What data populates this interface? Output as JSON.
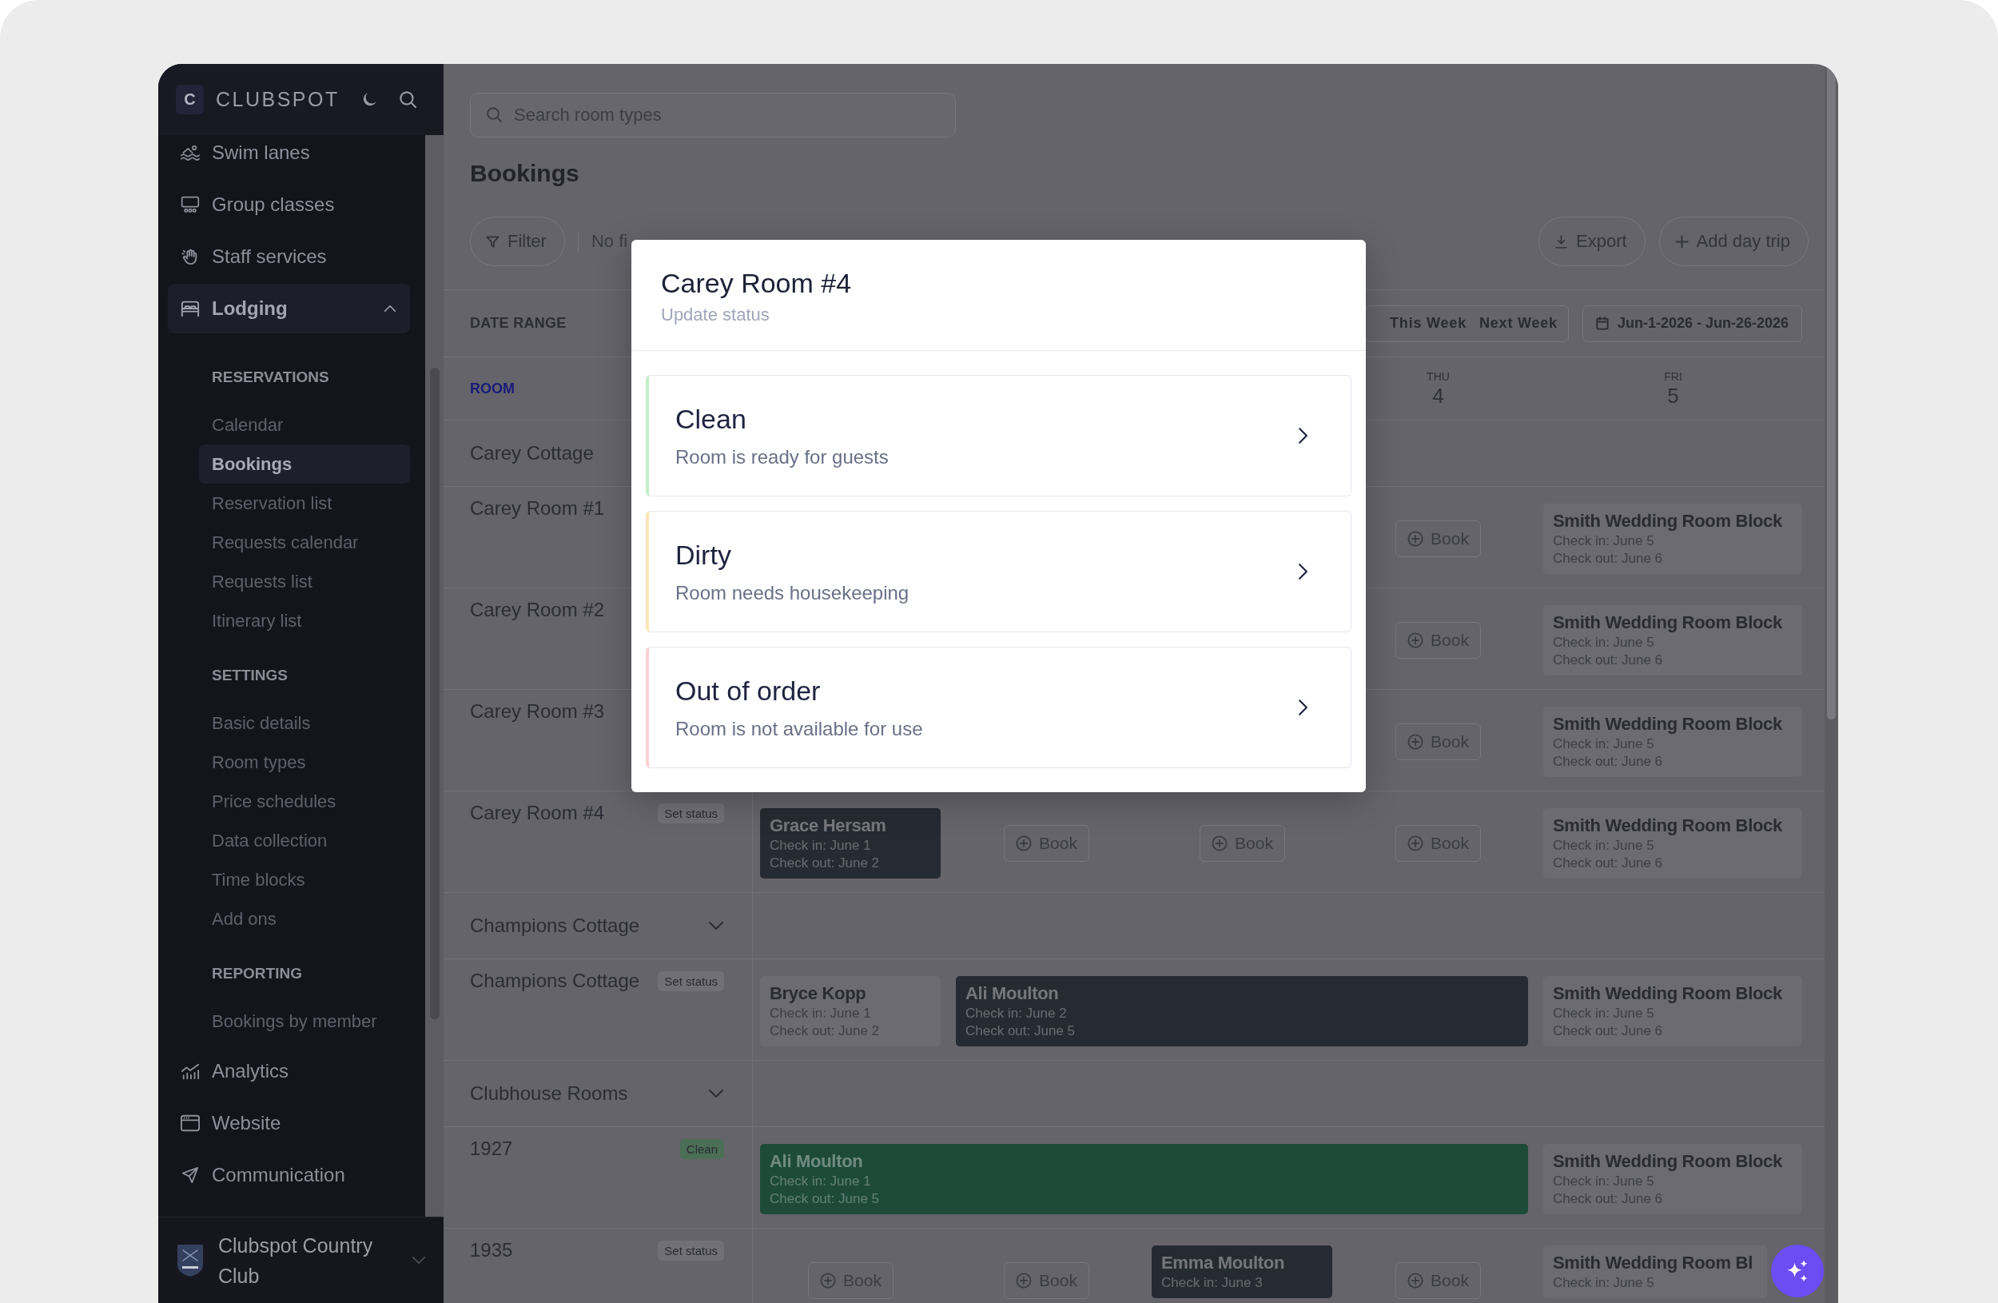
{
  "sidebar": {
    "brand": {
      "logo": "C",
      "name": "CLUBSPOT"
    },
    "nav": [
      {
        "label": "Swim lanes",
        "selected": false
      },
      {
        "label": "Group classes",
        "selected": false
      },
      {
        "label": "Staff services",
        "selected": false
      },
      {
        "label": "Lodging",
        "selected": true,
        "expanded": true,
        "sections": [
          {
            "heading": "RESERVATIONS",
            "items": [
              {
                "label": "Calendar",
                "selected": false
              },
              {
                "label": "Bookings",
                "selected": true
              },
              {
                "label": "Reservation list",
                "selected": false
              },
              {
                "label": "Requests calendar",
                "selected": false
              },
              {
                "label": "Requests list",
                "selected": false
              },
              {
                "label": "Itinerary list",
                "selected": false
              }
            ]
          },
          {
            "heading": "SETTINGS",
            "items": [
              {
                "label": "Basic details",
                "selected": false
              },
              {
                "label": "Room types",
                "selected": false
              },
              {
                "label": "Price schedules",
                "selected": false
              },
              {
                "label": "Data collection",
                "selected": false
              },
              {
                "label": "Time blocks",
                "selected": false
              },
              {
                "label": "Add ons",
                "selected": false
              }
            ]
          },
          {
            "heading": "REPORTING",
            "items": [
              {
                "label": "Bookings by member",
                "selected": false
              }
            ]
          }
        ]
      },
      {
        "label": "Analytics",
        "selected": false
      },
      {
        "label": "Website",
        "selected": false
      },
      {
        "label": "Communication",
        "selected": false
      }
    ],
    "club": {
      "name": "Clubspot Country Club"
    }
  },
  "main": {
    "search": {
      "placeholder": "Search room types"
    },
    "title": "Bookings",
    "toolbar": {
      "filter": "Filter",
      "filter_summary": "No fi",
      "actions": [
        {
          "label": "Export"
        },
        {
          "label": "Add day trip"
        }
      ]
    },
    "date_range": {
      "label": "DATE RANGE",
      "presets": [
        {
          "label": "This Week",
          "selected": false
        },
        {
          "label": "Next Week",
          "selected": false
        }
      ],
      "value": "Jun-1-2026 - Jun-26-2026"
    },
    "calendar": {
      "room_heading": "ROOM",
      "days": [
        {
          "kind": "empty"
        },
        {
          "kind": "empty"
        },
        {
          "kind": "empty"
        },
        {
          "kind": "day",
          "weekday": "THU",
          "date": "4"
        },
        {
          "kind": "day",
          "weekday": "FRI",
          "date": "5"
        }
      ],
      "rows": [
        {
          "kind": "group",
          "label": "Carey Cottage"
        },
        {
          "kind": "room",
          "label": "Carey Room #1",
          "days": [
            {
              "kind": "empty"
            },
            {
              "kind": "empty"
            },
            {
              "kind": "empty"
            },
            {
              "kind": "book",
              "label": "Book"
            },
            {
              "kind": "booking",
              "name": "Smith Wedding Room Block",
              "check_in": "Check in: June 5",
              "check_out": "Check out: June 6",
              "color": "#6c6b71"
            }
          ]
        },
        {
          "kind": "room",
          "label": "Carey Room #2",
          "days": [
            {
              "kind": "empty"
            },
            {
              "kind": "empty"
            },
            {
              "kind": "empty"
            },
            {
              "kind": "book",
              "label": "Book"
            },
            {
              "kind": "booking",
              "name": "Smith Wedding Room Block",
              "check_in": "Check in: June 5",
              "check_out": "Check out: June 6",
              "color": "#6c6b71"
            }
          ]
        },
        {
          "kind": "room",
          "label": "Carey Room #3",
          "days": [
            {
              "kind": "empty"
            },
            {
              "kind": "empty"
            },
            {
              "kind": "empty"
            },
            {
              "kind": "book",
              "label": "Book"
            },
            {
              "kind": "booking",
              "name": "Smith Wedding Room Block",
              "check_in": "Check in: June 5",
              "check_out": "Check out: June 6",
              "color": "#6c6b71"
            }
          ]
        },
        {
          "kind": "room",
          "label": "Carey Room #4",
          "status": {
            "label": "Set status",
            "color": "#717076"
          },
          "days": [
            {
              "kind": "booking",
              "name": "Grace Hersam",
              "check_in": "Check in: June 1",
              "check_out": "Check out: June 2",
              "color": "#262a33"
            },
            {
              "kind": "book",
              "label": "Book"
            },
            {
              "kind": "book",
              "label": "Book"
            },
            {
              "kind": "book",
              "label": "Book"
            },
            {
              "kind": "booking",
              "name": "Smith Wedding Room Block",
              "check_in": "Check in: June 5",
              "check_out": "Check out: June 6",
              "color": "#6c6b71"
            }
          ]
        },
        {
          "kind": "group",
          "label": "Champions Cottage",
          "expanded": true
        },
        {
          "kind": "room",
          "label": "Champions Cottage",
          "status": {
            "label": "Set status",
            "color": "#717076"
          },
          "days": [
            {
              "kind": "booking",
              "name": "Bryce Kopp",
              "check_in": "Check in: June 1",
              "check_out": "Check out: June 2",
              "color": "#6c6b71"
            },
            {
              "kind": "booking",
              "name": "Ali Moulton",
              "check_in": "Check in: June 2",
              "check_out": "Check out: June 5",
              "color": "#262a33"
            },
            {
              "kind": "stay"
            },
            {
              "kind": "stay"
            },
            {
              "kind": "booking",
              "name": "Smith Wedding Room Block",
              "check_in": "Check in: June 5",
              "check_out": "Check out: June 6",
              "color": "#6c6b71"
            }
          ]
        },
        {
          "kind": "group",
          "label": "Clubhouse Rooms",
          "expanded": true
        },
        {
          "kind": "room",
          "label": "1927",
          "status": {
            "label": "Clean",
            "color": "#4b6e56"
          },
          "days": [
            {
              "kind": "booking",
              "name": "Ali Moulton",
              "check_in": "Check in: June 1",
              "check_out": "Check out: June 5",
              "color": "#1e4a3a"
            },
            {
              "kind": "stay"
            },
            {
              "kind": "stay"
            },
            {
              "kind": "stay"
            },
            {
              "kind": "booking",
              "name": "Smith Wedding Room Block",
              "check_in": "Check in: June 5",
              "check_out": "Check out: June 6",
              "color": "#6c6b71"
            }
          ]
        },
        {
          "kind": "room",
          "label": "1935",
          "status": {
            "label": "Set status",
            "color": "#717076"
          },
          "days": [
            {
              "kind": "book",
              "label": "Book"
            },
            {
              "kind": "book",
              "label": "Book"
            },
            {
              "kind": "booking",
              "name": "Emma Moulton",
              "check_in": "Check in: June 3",
              "color": "#262a33"
            },
            {
              "kind": "book",
              "label": "Book"
            },
            {
              "kind": "booking",
              "name": "Smith Wedding Room Bl",
              "check_in": "Check in: June 5",
              "color": "#6c6b71"
            }
          ]
        }
      ]
    }
  },
  "modal": {
    "title": "Carey Room #4",
    "subtitle": "Update status",
    "options": [
      {
        "title": "Clean",
        "description": "Room is ready for guests",
        "color": "#c5eec6"
      },
      {
        "title": "Dirty",
        "description": "Room needs housekeeping",
        "color": "#fbe5b5"
      },
      {
        "title": "Out of order",
        "description": "Room is not available for use",
        "color": "#fbd1d1"
      }
    ]
  }
}
